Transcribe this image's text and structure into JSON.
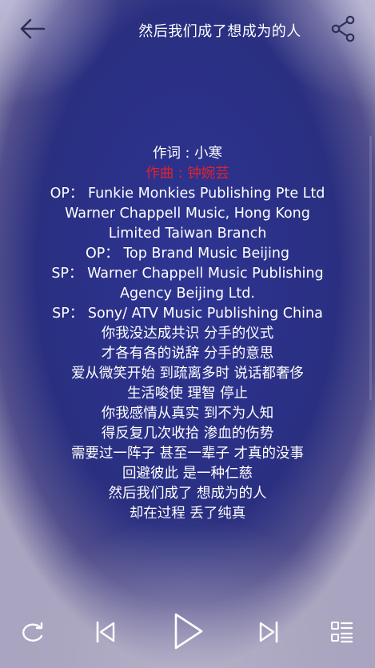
{
  "header": {
    "title": "然后我们成了想成为的人",
    "back_icon": "arrow-left-icon",
    "share_icon": "share-icon"
  },
  "lyrics": {
    "active_index": 1,
    "active_color": "#e0212e",
    "lines": [
      "作词 : 小寒",
      "作曲 : 钟婉芸",
      "OP： Funkie Monkies Publishing Pte Ltd Warner Chappell Music, Hong Kong Limited Taiwan Branch",
      "OP： Top Brand Music Beijing",
      "SP： Warner Chappell Music Publishing Agency Beijing Ltd.",
      "SP： Sony/ ATV Music Publishing China",
      "你我没达成共识 分手的仪式",
      "才各有各的说辞 分手的意思",
      "爱从微笑开始 到疏离多时 说话都奢侈",
      "生活唆使 理智 停止",
      "你我感情从真实 到不为人知",
      "得反复几次收拾 渗血的伤势",
      "需要过一阵子 甚至一辈子 才真的没事",
      "回避彼此 是一种仁慈",
      "然后我们成了 想成为的人",
      "却在过程 丢了纯真"
    ]
  },
  "controls": {
    "repeat_icon": "repeat-icon",
    "previous_icon": "skip-previous-icon",
    "play_icon": "play-icon",
    "next_icon": "skip-next-icon",
    "playlist_icon": "playlist-icon"
  }
}
